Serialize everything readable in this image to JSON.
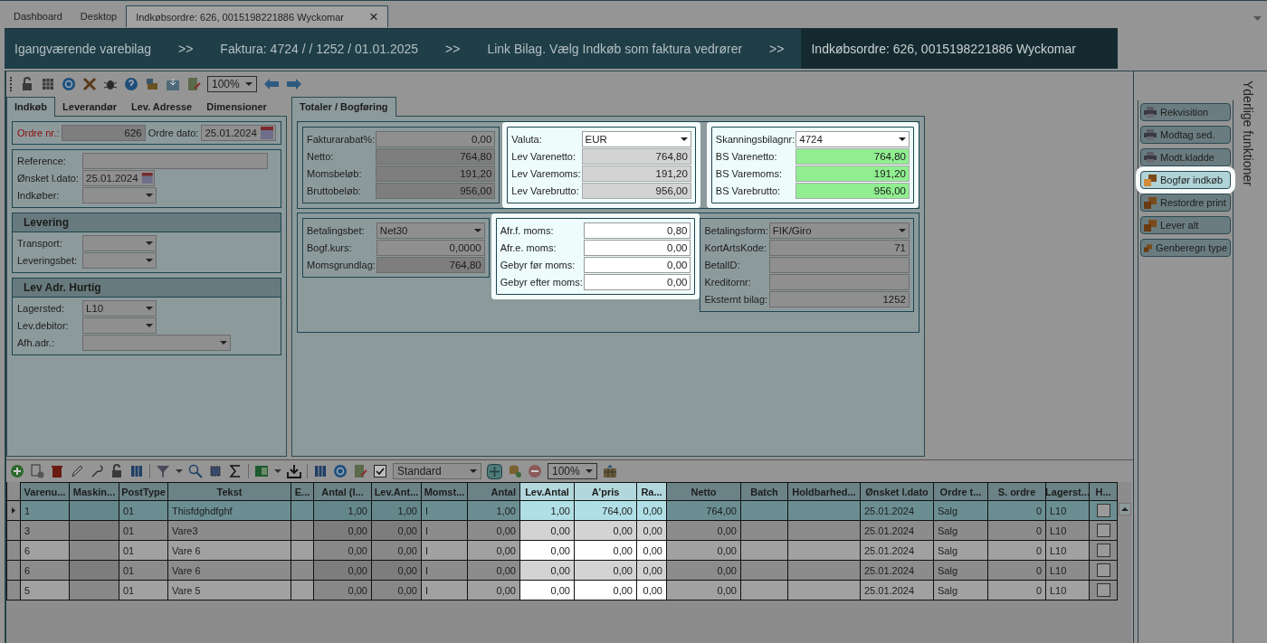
{
  "tabs": [
    {
      "label": "Dashboard",
      "selected": false
    },
    {
      "label": "Desktop",
      "selected": false
    },
    {
      "label": "Indkøbsordre: 626, 0015198221886 Wyckomar",
      "selected": true
    }
  ],
  "close_glyph": "×",
  "breadcrumb": [
    {
      "kind": "item",
      "label": "Igangværende varebilag",
      "selected": false
    },
    {
      "kind": "separator",
      "label": ">>"
    },
    {
      "kind": "item",
      "label": "Faktura: 4724 /  / 1252 / 01.01.2025",
      "selected": false
    },
    {
      "kind": "separator",
      "label": ">>"
    },
    {
      "kind": "item",
      "label": "Link Bilag. Vælg Indkøb som faktura vedrører",
      "selected": false
    },
    {
      "kind": "separator",
      "label": ">>"
    },
    {
      "kind": "item",
      "label": "Indkøbsordre: 626, 0015198221886 Wyckomar",
      "selected": true
    }
  ],
  "toolbar": {
    "zoom": "100%"
  },
  "left_tabs": [
    {
      "label": "Indkøb",
      "selected": true
    },
    {
      "label": "Leverandør",
      "selected": false
    },
    {
      "label": "Lev. Adresse",
      "selected": false
    },
    {
      "label": "Dimensioner",
      "selected": false
    }
  ],
  "order": {
    "fields": [
      {
        "label": "Ordre nr.:",
        "value": "626",
        "kind": "readonly",
        "required": true
      },
      {
        "label": "Ordre dato:",
        "value": "25.01.2024",
        "kind": "date",
        "required": false
      }
    ]
  },
  "left_groups": [
    {
      "fields": [
        {
          "label": "Reference:",
          "kind": "text"
        },
        {
          "label": "Ønsket l.dato:",
          "value": "25.01.2024",
          "kind": "date"
        },
        {
          "label": "Indkøber:",
          "kind": "dropdown"
        }
      ]
    },
    {
      "title": "Levering",
      "fields": [
        {
          "label": "Transport:",
          "kind": "dropdown"
        },
        {
          "label": "Leveringsbet:",
          "kind": "dropdown"
        }
      ]
    },
    {
      "title": "Lev Adr. Hurtig",
      "fields": [
        {
          "label": "Lagersted:",
          "value": "L10",
          "kind": "dropdown"
        },
        {
          "label": "Lev.debitor:",
          "kind": "dropdown"
        },
        {
          "label": "Afh.adr.:",
          "kind": "dropdown"
        }
      ]
    }
  ],
  "right_tabs": [
    {
      "label": "Totaler / Bogføring",
      "selected": true
    }
  ],
  "totals_rows": [
    [
      {
        "highlighted": false,
        "fields": [
          {
            "label": "Fakturarabat%:",
            "value": "0,00",
            "kind": "input"
          },
          {
            "label": "Netto:",
            "value": "764,80",
            "kind": "readonly"
          },
          {
            "label": "Momsbeløb:",
            "value": "191,20",
            "kind": "readonly"
          },
          {
            "label": "Bruttobeløb:",
            "value": "956,00",
            "kind": "readonly"
          }
        ]
      },
      {
        "highlighted": true,
        "fields": [
          {
            "label": "Valuta:",
            "value": "EUR",
            "kind": "dropdown"
          },
          {
            "label": "Lev Varenetto:",
            "value": "764,80",
            "kind": "readonly"
          },
          {
            "label": "Lev Varemoms:",
            "value": "191,20",
            "kind": "readonly"
          },
          {
            "label": "Lev Varebrutto:",
            "value": "956,00",
            "kind": "readonly"
          }
        ]
      },
      {
        "highlighted": true,
        "fields": [
          {
            "label": "Skanningsbilagnr:",
            "value": "4724",
            "kind": "dropdown"
          },
          {
            "label": "BS Varenetto:",
            "value": "764,80",
            "kind": "match"
          },
          {
            "label": "BS Varemoms:",
            "value": "191,20",
            "kind": "match"
          },
          {
            "label": "BS Varebrutto:",
            "value": "956,00",
            "kind": "match"
          }
        ]
      }
    ],
    [
      {
        "highlighted": false,
        "fields": [
          {
            "label": "Betalingsbet:",
            "value": "Net30",
            "kind": "dropdown"
          },
          {
            "label": "Bogf.kurs:",
            "value": "0,0000",
            "kind": "input"
          },
          {
            "label": "Momsgrundlag:",
            "value": "764,80",
            "kind": "readonly"
          }
        ]
      },
      {
        "highlighted": true,
        "fields": [
          {
            "label": "Afr.f. moms:",
            "value": "0,80",
            "kind": "input"
          },
          {
            "label": "Afr.e. moms:",
            "value": "0,00",
            "kind": "input"
          },
          {
            "label": "Gebyr før moms:",
            "value": "0,00",
            "kind": "input"
          },
          {
            "label": "Gebyr efter moms:",
            "value": "0,00",
            "kind": "input"
          }
        ]
      },
      {
        "highlighted": false,
        "fields": [
          {
            "label": "Betalingsform:",
            "value": "FIK/Giro",
            "kind": "dropdown"
          },
          {
            "label": "KortArtsKode:",
            "value": "71",
            "kind": "input"
          },
          {
            "label": "BetalID:",
            "kind": "input"
          },
          {
            "label": "Kreditornr:",
            "kind": "input"
          },
          {
            "label": "Eksternt bilag:",
            "value": "1252",
            "kind": "input"
          }
        ]
      }
    ]
  ],
  "grid_toolbar": {
    "layout": "Standard",
    "zoom": "100%"
  },
  "grid": {
    "columns": [
      {
        "label": "Varenu...",
        "readonly": false,
        "highlighted": false
      },
      {
        "label": "Maskin...",
        "readonly": true,
        "highlighted": false
      },
      {
        "label": "PostType",
        "readonly": false,
        "highlighted": false
      },
      {
        "label": "Tekst",
        "readonly": false,
        "highlighted": false
      },
      {
        "label": "E...",
        "readonly": false,
        "highlighted": false
      },
      {
        "label": "Antal (I...",
        "readonly": true,
        "highlighted": false
      },
      {
        "label": "Lev.Ant...",
        "readonly": true,
        "highlighted": false
      },
      {
        "label": "Momst...",
        "readonly": false,
        "highlighted": false
      },
      {
        "label": "Antal",
        "readonly": false,
        "highlighted": false
      },
      {
        "label": "Lev.Antal",
        "readonly": false,
        "highlighted": true
      },
      {
        "label": "A'pris",
        "readonly": false,
        "highlighted": true
      },
      {
        "label": "Ra...",
        "readonly": false,
        "highlighted": true
      },
      {
        "label": "Netto",
        "readonly": false,
        "highlighted": false
      },
      {
        "label": "Batch",
        "readonly": false,
        "highlighted": false
      },
      {
        "label": "Holdbarhed...",
        "readonly": false,
        "highlighted": false
      },
      {
        "label": "Ønsket l.dato",
        "readonly": false,
        "highlighted": false
      },
      {
        "label": "Ordre t...",
        "readonly": false,
        "highlighted": false
      },
      {
        "label": "S. ordre",
        "readonly": false,
        "highlighted": false
      },
      {
        "label": "Lagerst...",
        "readonly": false,
        "highlighted": false
      },
      {
        "label": "H...",
        "readonly": false,
        "highlighted": false
      }
    ],
    "rows": [
      {
        "selected": true,
        "checked": false,
        "cells": [
          "1",
          null,
          "01",
          "Thisfdghdfghf",
          null,
          "1,00",
          "1,00",
          "I",
          "1,00",
          "1,00",
          "764,00",
          "0,00",
          "764,00",
          null,
          null,
          "25.01.2024",
          "Salg",
          "0",
          "L10"
        ]
      },
      {
        "selected": false,
        "checked": false,
        "cells": [
          "3",
          null,
          "01",
          "Vare3",
          null,
          "0,00",
          "0,00",
          "I",
          "0,00",
          "0,00",
          "0,00",
          "0,00",
          "0,00",
          null,
          null,
          "25.01.2024",
          "Salg",
          "0",
          "L10"
        ]
      },
      {
        "selected": false,
        "checked": false,
        "cells": [
          "6",
          null,
          "01",
          "Vare 6",
          null,
          "0,00",
          "0,00",
          "I",
          "0,00",
          "0,00",
          "0,00",
          "0,00",
          "0,00",
          null,
          null,
          "25.01.2024",
          "Salg",
          "0",
          "L10"
        ]
      },
      {
        "selected": false,
        "checked": false,
        "cells": [
          "6",
          null,
          "01",
          "Vare 6",
          null,
          "0,00",
          "0,00",
          "I",
          "0,00",
          "0,00",
          "0,00",
          "0,00",
          "0,00",
          null,
          null,
          "25.01.2024",
          "Salg",
          "0",
          "L10"
        ]
      },
      {
        "selected": false,
        "checked": false,
        "cells": [
          "5",
          null,
          "01",
          "Vare 5",
          null,
          "0,00",
          "0,00",
          "I",
          "0,00",
          "0,00",
          "0,00",
          "0,00",
          "0,00",
          null,
          null,
          "25.01.2024",
          "Salg",
          "0",
          "L10"
        ]
      }
    ]
  },
  "side": {
    "title": "Yderlige funktioner",
    "buttons": [
      {
        "label": "Rekvisition",
        "kind": "print",
        "highlighted": false
      },
      {
        "label": "Modtag sed.",
        "kind": "print",
        "highlighted": false
      },
      {
        "label": "Modt.kladde",
        "kind": "print",
        "highlighted": false
      },
      {
        "label": "Bogfør indkøb",
        "kind": "action",
        "highlighted": true
      },
      {
        "label": "Restordre print",
        "kind": "action",
        "highlighted": false
      },
      {
        "label": "Lever alt",
        "kind": "action",
        "highlighted": false
      },
      {
        "label": "Genberegn type",
        "kind": "action",
        "highlighted": false
      }
    ]
  }
}
